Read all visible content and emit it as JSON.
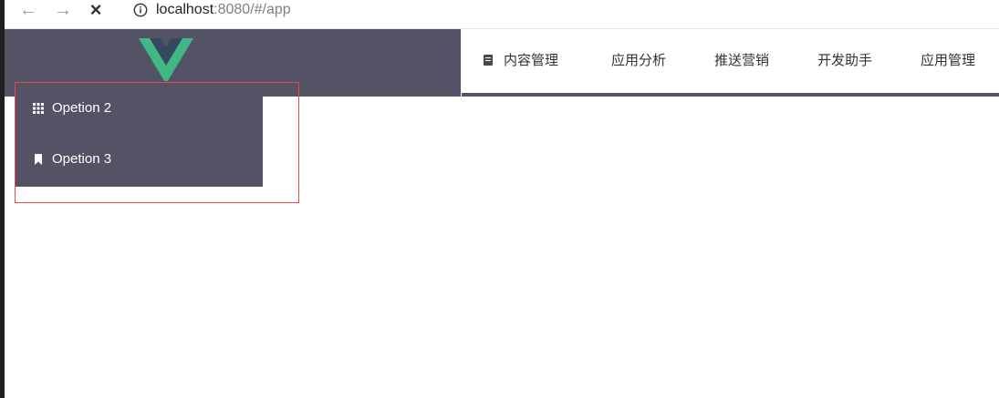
{
  "browser": {
    "back_icon": "arrow-left-icon",
    "forward_icon": "arrow-right-icon",
    "stop_icon": "close-icon",
    "info_icon": "info-icon",
    "url_host": "localhost",
    "url_rest": ":8080/#/app"
  },
  "header": {
    "logo_icon": "vue-logo-icon",
    "menu": [
      {
        "label": "内容管理",
        "icon": "document-icon"
      },
      {
        "label": "应用分析"
      },
      {
        "label": "推送营销"
      },
      {
        "label": "开发助手"
      },
      {
        "label": "应用管理"
      }
    ]
  },
  "dropdown": {
    "items": [
      {
        "label": "Opetion 2",
        "icon": "grid-icon"
      },
      {
        "label": "Opetion 3",
        "icon": "bookmark-icon"
      }
    ]
  },
  "colors": {
    "header_bg": "#545265",
    "vue_green": "#41b883",
    "vue_dark": "#34495e",
    "highlight": "#e34a4a"
  }
}
